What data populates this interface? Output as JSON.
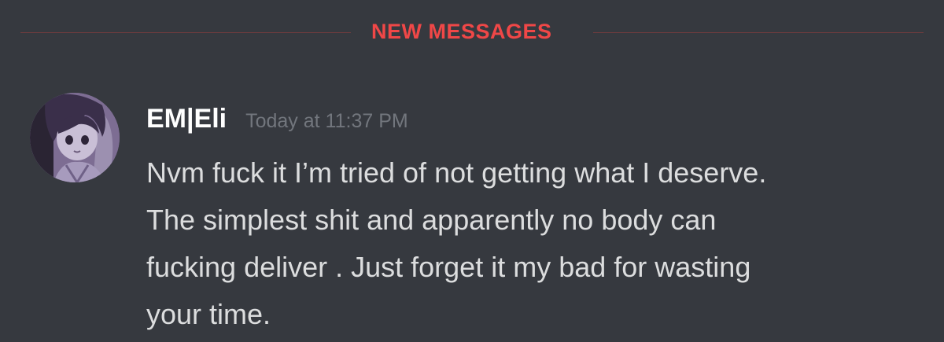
{
  "divider": {
    "label": "NEW MESSAGES",
    "color": "#f04747"
  },
  "message": {
    "author": "EM|Eli",
    "timestamp": "Today at 11:37 PM",
    "avatar_icon": "anime-character-avatar-icon",
    "content_lines": [
      "Nvm fuck it I’m tried of not getting what I deserve.",
      "The simplest shit and apparently no body can",
      "fucking deliver . Just forget it my bad for wasting",
      "your time."
    ]
  },
  "colors": {
    "background": "#36393f",
    "username": "#ffffff",
    "timestamp": "#72767d",
    "text": "#dcddde",
    "avatar_tint": "#7a6a8e"
  }
}
